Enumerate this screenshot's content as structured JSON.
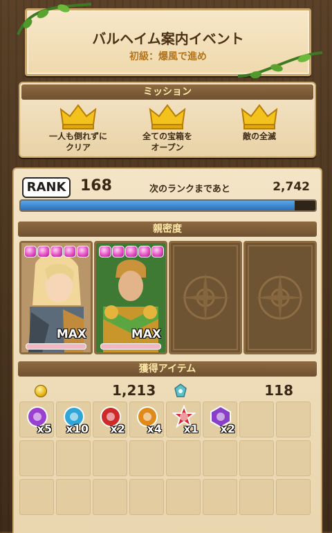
{
  "event": {
    "title": "バルヘイム案内イベント",
    "subtitle": "初級：爆風で進め"
  },
  "mission": {
    "header": "ミッション",
    "items": [
      {
        "label_line1": "一人も倒れずに",
        "label_line2": "クリア",
        "icon": "crown-icon"
      },
      {
        "label_line1": "全ての宝箱を",
        "label_line2": "オープン",
        "icon": "crown-icon"
      },
      {
        "label_line1": "敵の全滅",
        "label_line2": "",
        "icon": "crown-icon"
      }
    ]
  },
  "rank": {
    "badge": "RANK",
    "value": "168",
    "next_label": "次のランクまであと",
    "next_value": "2,742",
    "progress": 0.93
  },
  "affinity": {
    "header": "親密度",
    "cards": [
      {
        "hearts": 5,
        "max_label": "MAX",
        "filled": true
      },
      {
        "hearts": 5,
        "max_label": "MAX",
        "filled": true
      },
      {
        "filled": false
      },
      {
        "filled": false
      }
    ]
  },
  "items": {
    "header": "獲得アイテム",
    "coins": "1,213",
    "gems": "118",
    "drops": [
      {
        "icon": "purple-orb-icon",
        "color": "#9b3fd1",
        "count": "x5"
      },
      {
        "icon": "blue-orb-icon",
        "color": "#2fa6d8",
        "count": "x10"
      },
      {
        "icon": "red-orb-icon",
        "color": "#cf2a2a",
        "count": "x2"
      },
      {
        "icon": "orange-orb-icon",
        "color": "#e08a1a",
        "count": "x4"
      },
      {
        "icon": "red-star-icon",
        "color": "#d8262e",
        "count": "x1"
      },
      {
        "icon": "purple-gem-icon",
        "color": "#8a3fc8",
        "count": "x2"
      }
    ]
  }
}
